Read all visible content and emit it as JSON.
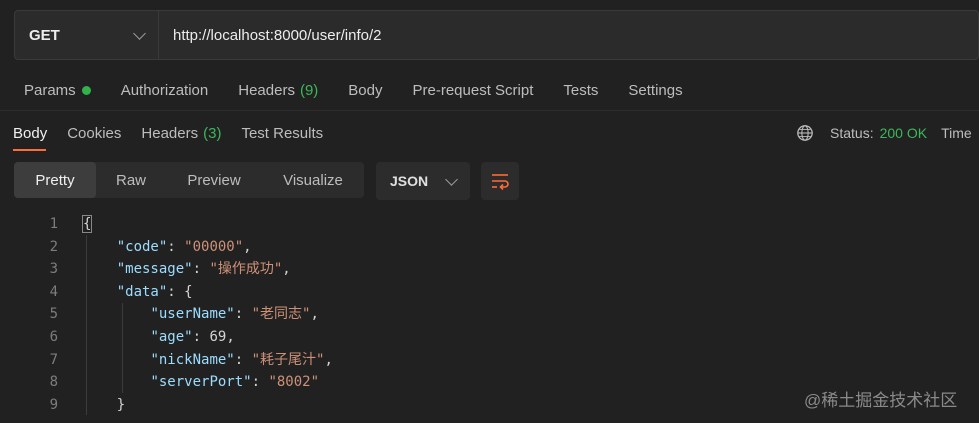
{
  "request": {
    "method": "GET",
    "url": "http://localhost:8000/user/info/2"
  },
  "request_tabs": [
    {
      "label": "Params",
      "has_dot": true,
      "dot_color": "#2fb34a"
    },
    {
      "label": "Authorization"
    },
    {
      "label": "Headers",
      "count": "(9)"
    },
    {
      "label": "Body"
    },
    {
      "label": "Pre-request Script"
    },
    {
      "label": "Tests"
    },
    {
      "label": "Settings"
    }
  ],
  "response_tabs": [
    {
      "label": "Body",
      "active": true
    },
    {
      "label": "Cookies"
    },
    {
      "label": "Headers",
      "count": "(3)"
    },
    {
      "label": "Test Results"
    }
  ],
  "status": {
    "icon": "globe-icon",
    "label": "Status:",
    "value": "200 OK",
    "value_color": "#3cb75a",
    "time_label": "Time"
  },
  "view_modes": [
    "Pretty",
    "Raw",
    "Preview",
    "Visualize"
  ],
  "active_view": "Pretty",
  "format": "JSON",
  "wrap_icon": "wrap-lines-icon",
  "code_lines": [
    {
      "n": "1",
      "indent": 0,
      "parts": [
        [
          "p",
          "{"
        ]
      ],
      "brace": true
    },
    {
      "n": "2",
      "indent": 1,
      "parts": [
        [
          "k",
          "\"code\""
        ],
        [
          "p",
          ": "
        ],
        [
          "s",
          "\"00000\""
        ],
        [
          "p",
          ","
        ]
      ]
    },
    {
      "n": "3",
      "indent": 1,
      "parts": [
        [
          "k",
          "\"message\""
        ],
        [
          "p",
          ": "
        ],
        [
          "s",
          "\"操作成功\""
        ],
        [
          "p",
          ","
        ]
      ]
    },
    {
      "n": "4",
      "indent": 1,
      "parts": [
        [
          "k",
          "\"data\""
        ],
        [
          "p",
          ": {"
        ]
      ]
    },
    {
      "n": "5",
      "indent": 2,
      "parts": [
        [
          "k",
          "\"userName\""
        ],
        [
          "p",
          ": "
        ],
        [
          "s",
          "\"老同志\""
        ],
        [
          "p",
          ","
        ]
      ]
    },
    {
      "n": "6",
      "indent": 2,
      "parts": [
        [
          "k",
          "\"age\""
        ],
        [
          "p",
          ": "
        ],
        [
          "n",
          "69"
        ],
        [
          "p",
          ","
        ]
      ]
    },
    {
      "n": "7",
      "indent": 2,
      "parts": [
        [
          "k",
          "\"nickName\""
        ],
        [
          "p",
          ": "
        ],
        [
          "s",
          "\"耗子尾汁\""
        ],
        [
          "p",
          ","
        ]
      ]
    },
    {
      "n": "8",
      "indent": 2,
      "parts": [
        [
          "k",
          "\"serverPort\""
        ],
        [
          "p",
          ": "
        ],
        [
          "s",
          "\"8002\""
        ]
      ]
    },
    {
      "n": "9",
      "indent": 1,
      "parts": [
        [
          "p",
          "}"
        ]
      ]
    }
  ],
  "watermark": "@稀土掘金技术社区"
}
